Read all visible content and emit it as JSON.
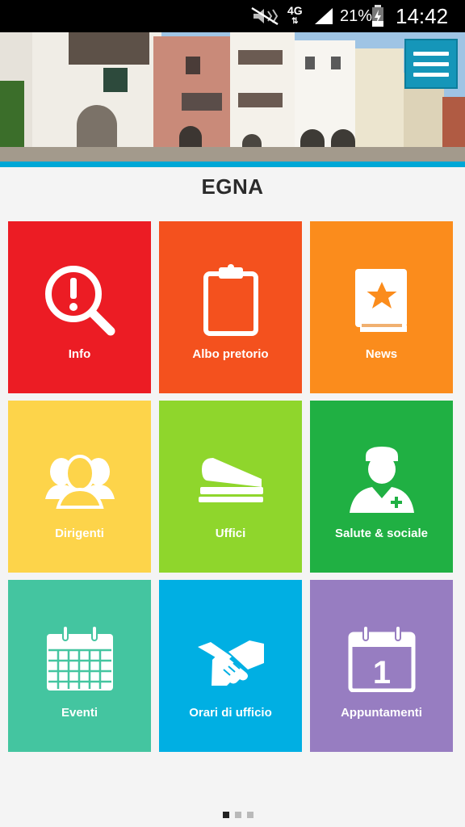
{
  "status_bar": {
    "network": "4G",
    "battery_percent": "21%",
    "time": "14:42",
    "icons": [
      "mute-icon",
      "signal-icon",
      "battery-charging-icon"
    ]
  },
  "header": {
    "menu_icon": "hamburger-menu-icon"
  },
  "page_title": "EGNA",
  "tiles": [
    {
      "label": "Info",
      "icon": "info-search-icon",
      "color": "#ec1c24"
    },
    {
      "label": "Albo pretorio",
      "icon": "clipboard-icon",
      "color": "#f4511e"
    },
    {
      "label": "News",
      "icon": "star-book-icon",
      "color": "#fb8c1c"
    },
    {
      "label": "Dirigenti",
      "icon": "people-group-icon",
      "color": "#fdd44a"
    },
    {
      "label": "Uffici",
      "icon": "stapler-icon",
      "color": "#8fd62c"
    },
    {
      "label": "Salute & sociale",
      "icon": "medic-icon",
      "color": "#20b043"
    },
    {
      "label": "Eventi",
      "icon": "calendar-grid-icon",
      "color": "#44c5a0"
    },
    {
      "label": "Orari di ufficio",
      "icon": "handshake-icon",
      "color": "#00afe3"
    },
    {
      "label": "Appuntamenti",
      "icon": "calendar-one-icon",
      "color": "#977dc1"
    }
  ],
  "calendar_day": "1",
  "pagination": {
    "pages": 3,
    "active": 1
  }
}
